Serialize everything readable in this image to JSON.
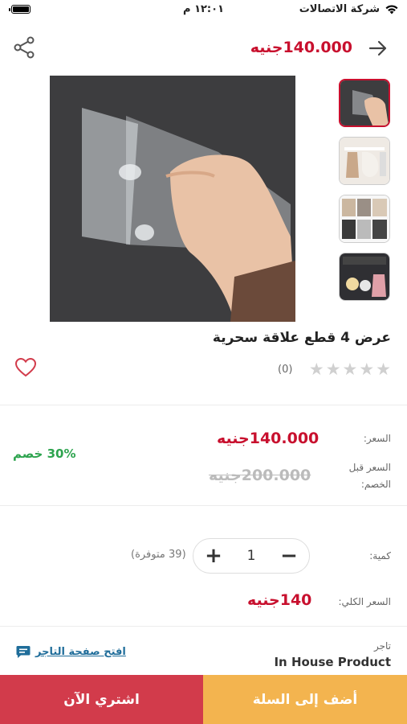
{
  "status_bar": {
    "carrier": "شركة الاتصالات",
    "time": "١٢:٠١ م"
  },
  "header": {
    "price": "140.000جنيه",
    "back_icon": "arrow-right-icon",
    "share_icon": "share-icon"
  },
  "product": {
    "title": "عرض 4 قطع علاقة سحرية",
    "rating_count": "(0)",
    "stars": 5
  },
  "pricing": {
    "price_label": "السعر:",
    "price": "140.000جنيه",
    "old_price_label": "السعر قبل الخصم:",
    "old_price": "200.000جنيه",
    "discount": "30% خصم"
  },
  "quantity": {
    "label": "كمية:",
    "value": "1",
    "stock": "(39 متوفرة)",
    "minus": "−",
    "plus": "+"
  },
  "total": {
    "label": "السعر الكلي:",
    "price": "140جنيه"
  },
  "seller": {
    "label": "تاجر",
    "name": "In House Product",
    "store_link": "افتح صفحة التاجر"
  },
  "footer": {
    "buy_now": "اشتري الآن",
    "add_to_cart": "أضف إلى السلة"
  },
  "colors": {
    "accent": "#c8102e",
    "buy": "#d23b4b",
    "cart": "#f3b44f",
    "discount": "#2ea44f"
  }
}
